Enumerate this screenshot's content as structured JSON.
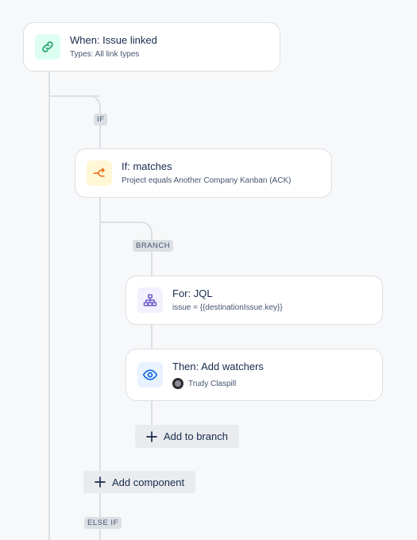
{
  "trigger": {
    "title": "When: Issue linked",
    "subtitle": "Types: All link types"
  },
  "labels": {
    "if": "IF",
    "branch": "BRANCH",
    "else_if": "ELSE IF"
  },
  "condition": {
    "title": "If: matches",
    "subtitle": "Project equals Another Company Kanban (ACK)"
  },
  "branch_for": {
    "title": "For: JQL",
    "subtitle": "issue = {{destinationIssue.key}}"
  },
  "action": {
    "title": "Then: Add watchers",
    "user": "Trudy Claspill"
  },
  "buttons": {
    "add_to_branch": "Add to branch",
    "add_component": "Add component"
  },
  "icons": {
    "trigger": "link-icon",
    "condition": "branch-split-icon",
    "for": "hierarchy-icon",
    "action": "eye-icon",
    "add": "plus-icon"
  },
  "colors": {
    "trigger_bg": "#dcfff1",
    "trigger_fg": "#22a06b",
    "condition_bg": "#fff7d6",
    "condition_fg": "#e56910",
    "for_bg": "#f3f0ff",
    "for_fg": "#6e5dc6",
    "action_bg": "#e9f2ff",
    "action_fg": "#0c66e4"
  }
}
